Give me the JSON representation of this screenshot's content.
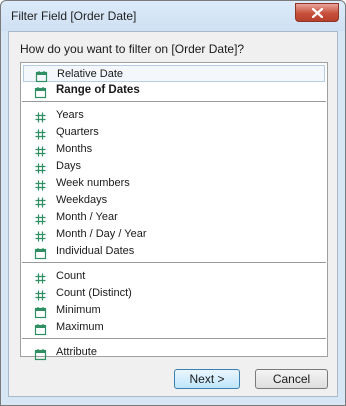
{
  "window": {
    "title": "Filter Field [Order Date]"
  },
  "dialog": {
    "question": "How do you want to filter on [Order Date]?",
    "groups": [
      [
        {
          "label": "Relative Date",
          "icon": "calendar-icon",
          "selected": true,
          "bold": false
        },
        {
          "label": "Range of Dates",
          "icon": "calendar-icon",
          "selected": false,
          "bold": true
        }
      ],
      [
        {
          "label": "Years",
          "icon": "hash-icon"
        },
        {
          "label": "Quarters",
          "icon": "hash-icon"
        },
        {
          "label": "Months",
          "icon": "hash-icon"
        },
        {
          "label": "Days",
          "icon": "hash-icon"
        },
        {
          "label": "Week numbers",
          "icon": "hash-icon"
        },
        {
          "label": "Weekdays",
          "icon": "hash-icon"
        },
        {
          "label": "Month / Year",
          "icon": "hash-icon"
        },
        {
          "label": "Month / Day / Year",
          "icon": "hash-icon"
        },
        {
          "label": "Individual Dates",
          "icon": "calendar-icon"
        }
      ],
      [
        {
          "label": "Count",
          "icon": "hash-icon"
        },
        {
          "label": "Count (Distinct)",
          "icon": "hash-icon"
        },
        {
          "label": "Minimum",
          "icon": "calendar-icon"
        },
        {
          "label": "Maximum",
          "icon": "calendar-icon"
        }
      ],
      [
        {
          "label": "Attribute",
          "icon": "calendar-icon"
        }
      ]
    ],
    "next_label": "Next >",
    "cancel_label": "Cancel"
  },
  "colors": {
    "icon_green": "#2f8f63",
    "selection_border": "#b7cde6"
  }
}
